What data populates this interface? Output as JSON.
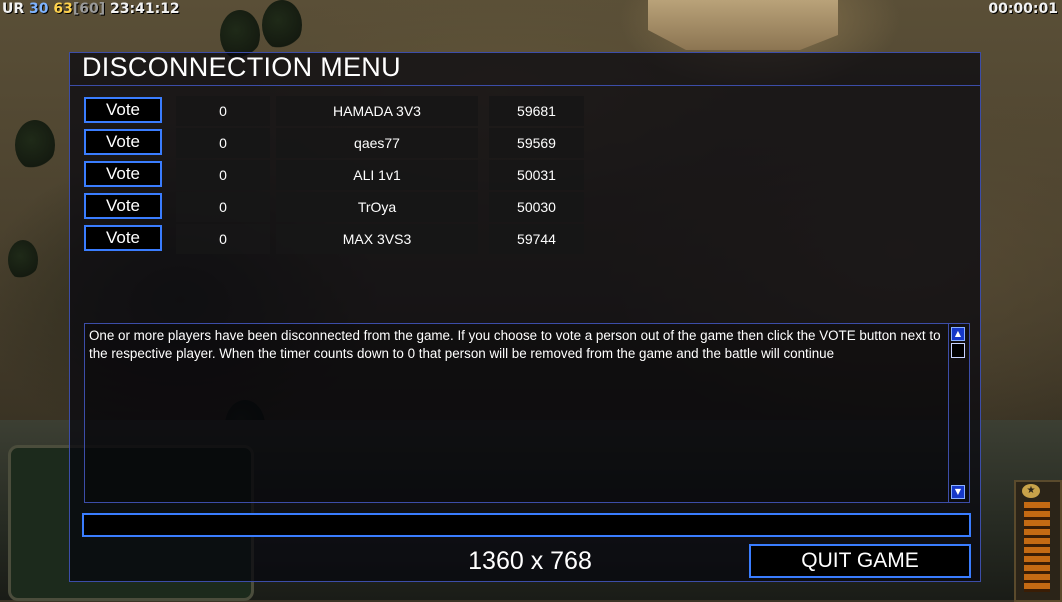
{
  "hud": {
    "prefix": "UR",
    "value1": "30",
    "value2": "63",
    "value3": "[60]",
    "clock": "23:41:12",
    "timer": "00:00:01"
  },
  "dialog": {
    "title": "DISCONNECTION MENU",
    "vote_label": "Vote",
    "players": [
      {
        "votes": "0",
        "name": "HAMADA 3V3",
        "id": "59681"
      },
      {
        "votes": "0",
        "name": "qaes77",
        "id": "59569"
      },
      {
        "votes": "0",
        "name": "ALI 1v1",
        "id": "50031"
      },
      {
        "votes": "0",
        "name": "TrOya",
        "id": "50030"
      },
      {
        "votes": "0",
        "name": "MAX 3VS3",
        "id": "59744"
      }
    ],
    "message": "One or more players have been disconnected from the game. If you choose to vote a person out of the game then click the VOTE button next to the respective player. When the timer counts down to 0 that person will be removed from the game and the battle will continue",
    "resolution": "1360 x 768",
    "quit_label": "QUIT GAME"
  },
  "colors": {
    "accent": "#3a7dff",
    "panel_border": "#3c4da8",
    "scroll_button": "#1638c8"
  },
  "icons": {
    "scroll_up": "triangle-up-icon",
    "scroll_down": "triangle-down-icon"
  }
}
